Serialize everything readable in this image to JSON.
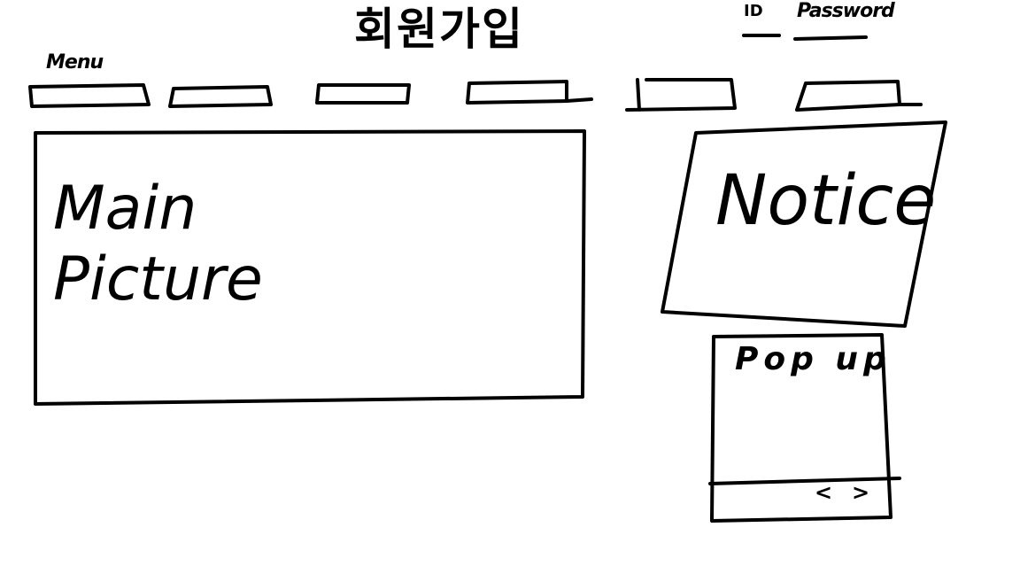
{
  "header": {
    "title": "회원가입",
    "login": {
      "id_label": "ID",
      "password_label": "Password"
    }
  },
  "nav": {
    "menu_label": "Menu",
    "tab_count": 6
  },
  "main_picture": {
    "label": "Main Picture"
  },
  "notice": {
    "label": "Notice"
  },
  "popup": {
    "label": "Pop up",
    "prev_label": "<",
    "next_label": ">"
  },
  "colors": {
    "background": "#ffffff",
    "ink": "#000000"
  }
}
